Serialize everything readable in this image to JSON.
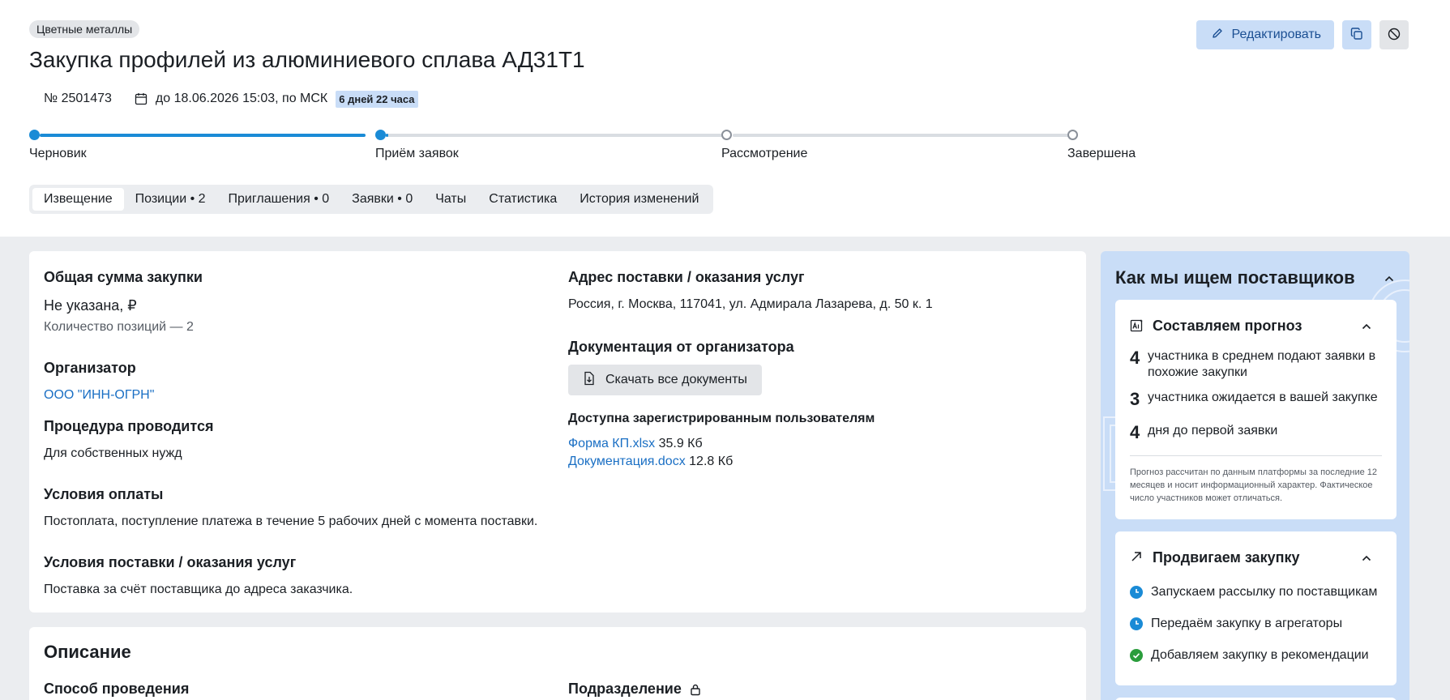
{
  "header": {
    "category": "Цветные металлы",
    "title": "Закупка профилей из алюминиевого сплава АД31Т1",
    "number": "№ 2501473",
    "deadline": "до 18.06.2026 15:03, по МСК",
    "time_left": "6 дней 22 часа",
    "edit_label": "Редактировать"
  },
  "stepper": {
    "steps": [
      {
        "label": "Черновик",
        "state": "done"
      },
      {
        "label": "Приём заявок",
        "state": "current"
      },
      {
        "label": "Рассмотрение",
        "state": "todo"
      },
      {
        "label": "Завершена",
        "state": "todo"
      }
    ]
  },
  "tabs": [
    {
      "label": "Извещение",
      "active": true
    },
    {
      "label": "Позиции • 2"
    },
    {
      "label": "Приглашения • 0"
    },
    {
      "label": "Заявки • 0"
    },
    {
      "label": "Чаты"
    },
    {
      "label": "Статистика"
    },
    {
      "label": "История изменений"
    }
  ],
  "main": {
    "total_heading": "Общая сумма закупки",
    "total_value": "Не указана, ₽",
    "positions_count": "Количество позиций — 2",
    "organizer_heading": "Организатор",
    "organizer_link": "ООО \"ИНН-ОГРН\"",
    "procedure_heading": "Процедура проводится",
    "procedure_value": "Для собственных нужд",
    "payment_heading": "Условия оплаты",
    "payment_value": "Постоплата, поступление платежа в течение 5 рабочих дней с момента поставки.",
    "delivery_heading": "Условия поставки / оказания услуг",
    "delivery_value": "Поставка за счёт поставщика до адреса заказчика.",
    "address_heading": "Адрес поставки / оказания услуг",
    "address_value": "Россия, г. Москва, 117041, ул. Адмирала Лазарева, д. 50 к. 1",
    "docs_heading": "Документация от организатора",
    "download_all": "Скачать все документы",
    "docs_access": "Доступна зарегистрированным пользователям",
    "docs": [
      {
        "name": "Форма КП.xlsx",
        "size": "35.9 Кб"
      },
      {
        "name": "Документация.docx",
        "size": "12.8 Кб"
      }
    ]
  },
  "description": {
    "heading": "Описание",
    "method_heading": "Способ проведения",
    "division_heading": "Подразделение"
  },
  "sidebar": {
    "title": "Как мы ищем поставщиков",
    "forecast": {
      "title": "Составляем прогноз",
      "stats": [
        {
          "num": "4",
          "text": "участника в среднем подают заявки в похожие закупки"
        },
        {
          "num": "3",
          "text": "участника ожидается в вашей закупке"
        },
        {
          "num": "4",
          "text": "дня до первой заявки"
        }
      ],
      "note": "Прогноз рассчитан по данным платформы за последние 12 месяцев и носит информационный характер. Фактическое число участников может отличаться."
    },
    "promo": {
      "title": "Продвигаем закупку",
      "items": [
        {
          "text": "Запускаем рассылку по поставщикам",
          "status": "pending"
        },
        {
          "text": "Передаём закупку в агрегаторы",
          "status": "pending"
        },
        {
          "text": "Добавляем закупку в рекомендации",
          "status": "done"
        }
      ]
    }
  },
  "colors": {
    "accent": "#1a8bd6",
    "link": "#1a6fc4",
    "sidebar_bg": "#c9ddf7",
    "success": "#2a9d3c"
  }
}
